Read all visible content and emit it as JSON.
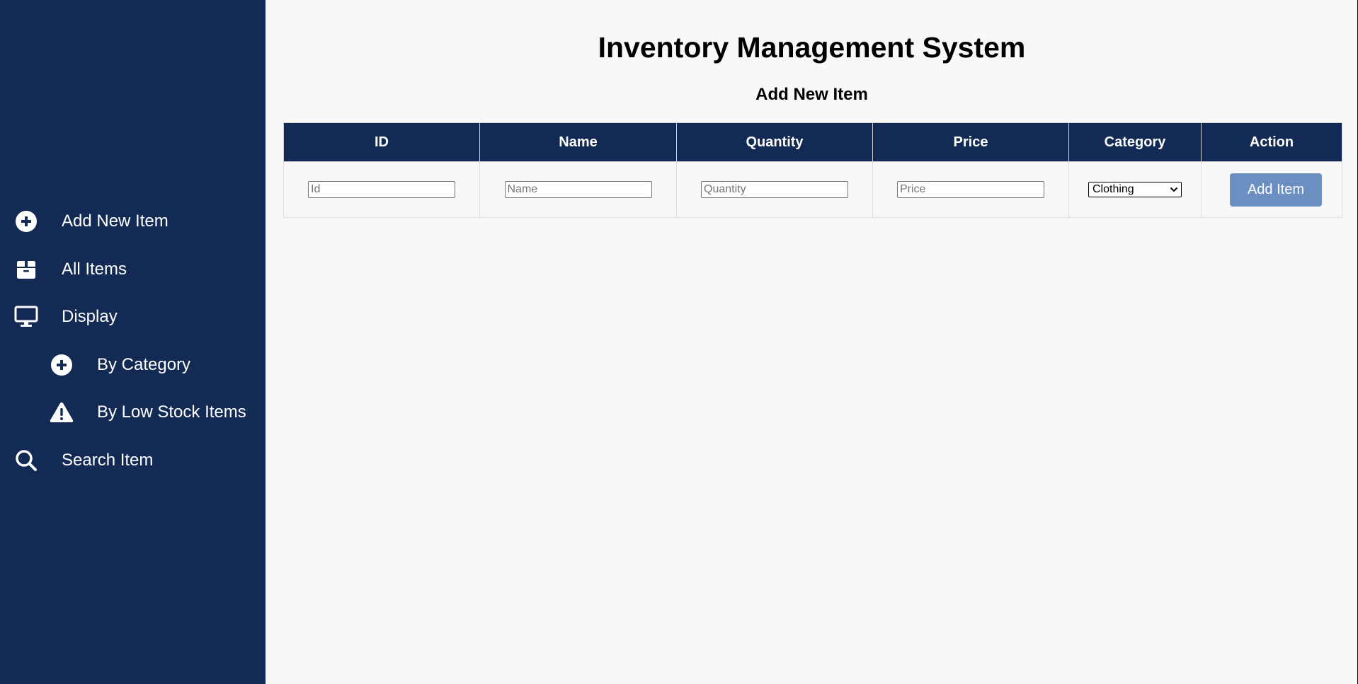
{
  "sidebar": {
    "items": [
      {
        "label": "Add New Item",
        "icon": "plus-circle-icon"
      },
      {
        "label": "All Items",
        "icon": "box-icon"
      },
      {
        "label": "Display",
        "icon": "monitor-icon"
      },
      {
        "label": "By Category",
        "icon": "plus-circle-icon"
      },
      {
        "label": "By Low Stock Items",
        "icon": "warning-icon"
      },
      {
        "label": "Search Item",
        "icon": "search-icon"
      }
    ]
  },
  "main": {
    "title": "Inventory Management System",
    "section_title": "Add New Item",
    "table": {
      "headers": [
        "ID",
        "Name",
        "Quantity",
        "Price",
        "Category",
        "Action"
      ],
      "inputs": {
        "id": {
          "placeholder": "Id",
          "value": ""
        },
        "name": {
          "placeholder": "Name",
          "value": ""
        },
        "quantity": {
          "placeholder": "Quantity",
          "value": ""
        },
        "price": {
          "placeholder": "Price",
          "value": ""
        }
      },
      "category_selected": "Clothing",
      "action_label": "Add Item"
    }
  },
  "colors": {
    "sidebar_bg": "#132a55",
    "header_bg": "#132a55",
    "button_bg": "#6c8fc1",
    "page_bg": "#f8f8f8"
  }
}
